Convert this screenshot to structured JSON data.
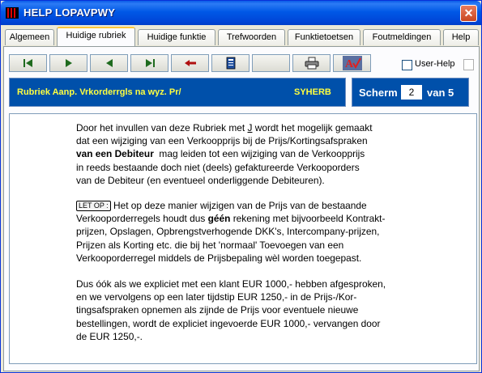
{
  "window": {
    "title": "HELP LOPAVPWY",
    "close_glyph": "✕"
  },
  "tabs": [
    {
      "label": "Algemeen",
      "active": false
    },
    {
      "label": "Huidige rubriek",
      "active": true
    },
    {
      "label": "Huidige funktie",
      "active": false
    },
    {
      "label": "Trefwoorden",
      "active": false
    },
    {
      "label": "Funktietoetsen",
      "active": false
    },
    {
      "label": "Foutmeldingen",
      "active": false
    },
    {
      "label": "Help",
      "active": false
    }
  ],
  "toolbar": {
    "buttons": [
      {
        "icon": "first-page-icon"
      },
      {
        "icon": "next-page-icon"
      },
      {
        "icon": "previous-page-icon"
      },
      {
        "icon": "last-page-icon"
      },
      {
        "icon": "back-icon"
      },
      {
        "icon": "index-book-icon"
      },
      {
        "icon": "blank-icon"
      },
      {
        "icon": "printer-icon"
      },
      {
        "icon": "spellcheck-icon"
      }
    ],
    "user_help_label": "User-Help",
    "user_help_checked": false
  },
  "rubriek": {
    "title": "Rubriek Aanp. Vrkorderrgls na wyz. Pr/",
    "code": "SYHERB"
  },
  "scherm": {
    "label": "Scherm",
    "current": "2",
    "of_label": "van 5"
  },
  "help_text": {
    "p1": {
      "l1_a": "Door het invullen van deze Rubriek met ",
      "l1_j": "J",
      "l1_b": " wordt het mogelijk gemaakt",
      "l2": "dat een wijziging van een Verkoopprijs bij de Prijs/Kortingsafspraken",
      "l3_bold": "van een Debiteur",
      "l3_rest": "  mag leiden tot een wijziging van de Verkoopprijs",
      "l4": "in reeds bestaande doch niet (deels) gefaktureerde Verkooporders",
      "l5": "van de Debiteur (en eventueel onderliggende Debiteuren)."
    },
    "p2": {
      "badge": "LET OP :",
      "l1": " Het op deze manier wijzigen van de Prijs van de bestaande",
      "l2_a": "Verkooporderregels houdt dus ",
      "l2_bold": "géén",
      "l2_b": " rekening met bijvoorbeeld Kontrakt-",
      "l3": "prijzen, Opslagen, Opbrengstverhogende DKK's, Intercompany-prijzen,",
      "l4": "Prijzen als Korting etc. die bij het 'normaal' Toevoegen van een",
      "l5": "Verkooporderregel middels de Prijsbepaling wèl worden toegepast."
    },
    "p3": {
      "l1": "Dus óók als we expliciet met een klant EUR 1000,- hebben afgesproken,",
      "l2": "en we vervolgens op een later tijdstip EUR 1250,- in de Prijs-/Kor-",
      "l3": "tingsafspraken opnemen als zijnde de Prijs voor eventuele nieuwe",
      "l4": "bestellingen, wordt de expliciet ingevoerde EUR 1000,- vervangen door",
      "l5": "de EUR 1250,-."
    }
  }
}
